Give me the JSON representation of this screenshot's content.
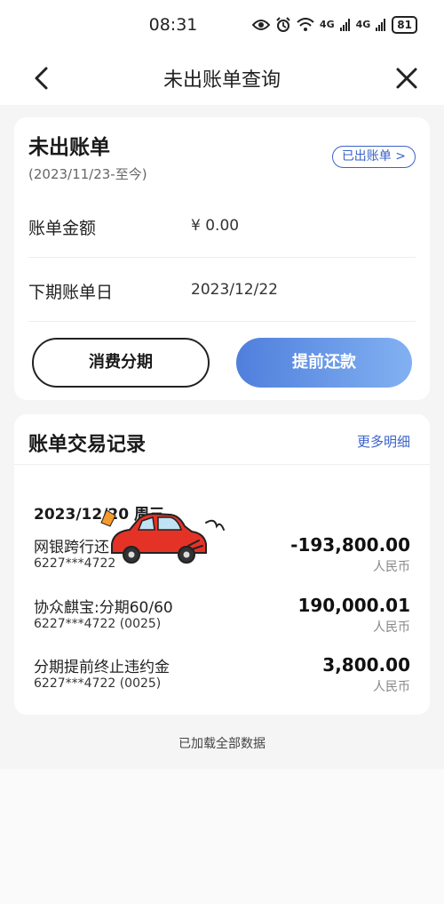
{
  "status_bar": {
    "time": "08:31",
    "eye_icon": "eye-icon",
    "alarm_icon": "alarm-icon",
    "wifi_icon": "wifi-icon",
    "signal1": "4G",
    "signal2": "4G",
    "battery": "81"
  },
  "nav": {
    "title": "未出账单查询",
    "back_icon": "chevron-left-icon",
    "close_icon": "close-icon"
  },
  "bill": {
    "title": "未出账单",
    "period": "(2023/11/23-至今)",
    "billed_link": "已出账单 >",
    "amount_label": "账单金额",
    "amount_value": "¥ 0.00",
    "next_label": "下期账单日",
    "next_value": "2023/12/22",
    "installment_button": "消费分期",
    "repay_button": "提前还款"
  },
  "transactions": {
    "title": "账单交易记录",
    "more_link": "更多明细",
    "date": "2023/12/20 周三",
    "items": [
      {
        "name": "网银跨行还",
        "card": "6227***4722",
        "amount": "-193,800.00",
        "currency": "人民币"
      },
      {
        "name": "协众麒宝:分期60/60",
        "card": "6227***4722 (0025)",
        "amount": "190,000.01",
        "currency": "人民币"
      },
      {
        "name": "分期提前终止违约金",
        "card": "6227***4722 (0025)",
        "amount": "3,800.00",
        "currency": "人民币"
      }
    ]
  },
  "footer": {
    "loaded_text": "已加载全部数据"
  },
  "colors": {
    "accent": "#3a63c8",
    "repay_gradient_start": "#4f7fdc",
    "repay_gradient_end": "#82b1f2",
    "background": "#f5f5f5"
  }
}
